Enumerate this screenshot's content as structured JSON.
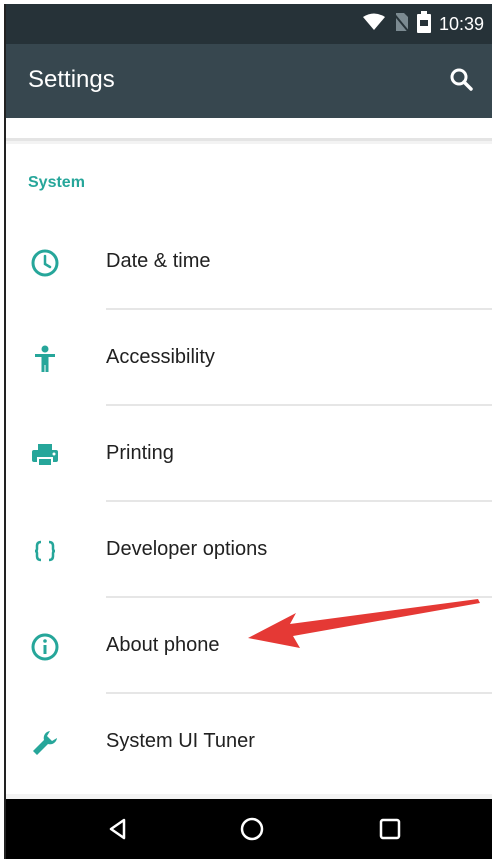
{
  "status_bar": {
    "time": "10:39",
    "icons": [
      "wifi-icon",
      "no-sim-icon",
      "battery-icon"
    ]
  },
  "app_bar": {
    "title": "Settings",
    "search_icon": "search-icon"
  },
  "section": {
    "header": "System",
    "items": [
      {
        "label": "Date & time",
        "icon": "clock-icon"
      },
      {
        "label": "Accessibility",
        "icon": "accessibility-icon"
      },
      {
        "label": "Printing",
        "icon": "printer-icon"
      },
      {
        "label": "Developer options",
        "icon": "braces-icon"
      },
      {
        "label": "About phone",
        "icon": "info-icon"
      },
      {
        "label": "System UI Tuner",
        "icon": "wrench-icon"
      }
    ]
  },
  "nav_bar": {
    "buttons": [
      "back-icon",
      "home-icon",
      "recents-icon"
    ]
  },
  "annotation": {
    "arrow_color": "#e53935",
    "target": "About phone"
  },
  "colors": {
    "accent": "#26a69a",
    "app_bar": "#37474f",
    "status_bar": "#263238"
  }
}
